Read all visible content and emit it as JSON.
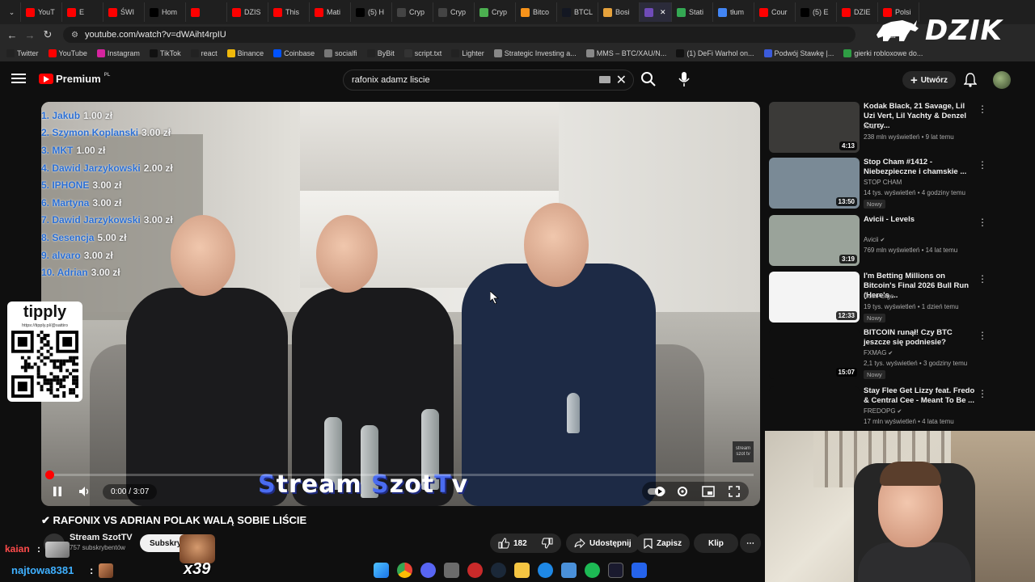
{
  "browser": {
    "tabs": [
      {
        "label": "YouT",
        "icon": "youtube-icon",
        "color": "#ff0000"
      },
      {
        "label": "E",
        "icon": "youtube-icon",
        "color": "#ff0000"
      },
      {
        "label": "ŚWI",
        "icon": "youtube-icon",
        "color": "#ff0000"
      },
      {
        "label": "Hom",
        "icon": "x-icon",
        "color": "#000000"
      },
      {
        "label": "",
        "icon": "youtube-icon",
        "color": "#ff0000"
      },
      {
        "label": "DZIS",
        "icon": "youtube-icon",
        "color": "#ff0000"
      },
      {
        "label": "This",
        "icon": "youtube-icon",
        "color": "#ff0000"
      },
      {
        "label": "Mati",
        "icon": "youtube-icon",
        "color": "#ff0000"
      },
      {
        "label": "(5) H",
        "icon": "x-icon",
        "color": "#000000"
      },
      {
        "label": "Cryp",
        "icon": "shield-icon",
        "color": "#444444"
      },
      {
        "label": "Cryp",
        "icon": "shield-icon",
        "color": "#444444"
      },
      {
        "label": "Cryp",
        "icon": "chrome-icon",
        "color": "#4caf50"
      },
      {
        "label": "Bitco",
        "icon": "bitcoin-icon",
        "color": "#f7931a"
      },
      {
        "label": "BTCL",
        "icon": "tradingview-icon",
        "color": "#131722"
      },
      {
        "label": "Bosi",
        "icon": "bookmark-icon",
        "color": "#e6a23c"
      },
      {
        "label": "",
        "icon": "active-tab-icon",
        "color": "#6f4bb8"
      },
      {
        "label": "Stati",
        "icon": "maps-icon",
        "color": "#34a853"
      },
      {
        "label": "tłum",
        "icon": "google-icon",
        "color": "#4285f4"
      },
      {
        "label": "Cour",
        "icon": "youtube-icon",
        "color": "#ff0000"
      },
      {
        "label": "(5) E",
        "icon": "x-icon",
        "color": "#000000"
      },
      {
        "label": "DZIE",
        "icon": "youtube-icon",
        "color": "#ff0000"
      },
      {
        "label": "Polsi",
        "icon": "youtube-icon",
        "color": "#ff0000"
      }
    ],
    "url": "youtube.com/watch?v=dWAiht4rpIU",
    "bookmarks": [
      {
        "label": "Twitter",
        "color": "#222222"
      },
      {
        "label": "YouTube",
        "color": "#ff0000"
      },
      {
        "label": "Instagram",
        "color": "#d6249f"
      },
      {
        "label": "TikTok",
        "color": "#111111"
      },
      {
        "label": "react",
        "color": "#222222"
      },
      {
        "label": "Binance",
        "color": "#f0b90b"
      },
      {
        "label": "Coinbase",
        "color": "#0052ff"
      },
      {
        "label": "socialfi",
        "color": "#777777"
      },
      {
        "label": "ByBit",
        "color": "#222222"
      },
      {
        "label": "script.txt",
        "color": "#333333"
      },
      {
        "label": "Lighter",
        "color": "#222222"
      },
      {
        "label": "Strategic Investing a...",
        "color": "#888888"
      },
      {
        "label": "MMS – BTC/XAU/N...",
        "color": "#888888"
      },
      {
        "label": "(1) DeFi Warhol on...",
        "color": "#111111"
      },
      {
        "label": "Podwój Stawkę |...",
        "color": "#3b5bdb"
      },
      {
        "label": "gierki robloxowe do...",
        "color": "#2f9e44"
      }
    ],
    "overlay_logo": "DZIK"
  },
  "youtube": {
    "logo": "Premium",
    "logo_region": "PL",
    "search_value": "rafonix adamz liscie",
    "create_label": "Utwórz",
    "video": {
      "title": "✔ RAFONIX VS ADRIAN POLAK WALĄ SOBIE LIŚCIE",
      "overlay_title_part1": "S",
      "overlay_title_part2": "tream ",
      "overlay_title_part3": "S",
      "overlay_title_part4": "zot",
      "overlay_title_part5": "T",
      "overlay_title_part6": "v",
      "watermark": "stream szot tv",
      "time": "0:00 / 3:07",
      "progress": 0.0,
      "donations": [
        {
          "name": "1. Jakub",
          "amount": "1.00 zł"
        },
        {
          "name": "2. Szymon Koplanski",
          "amount": "3.00 zł"
        },
        {
          "name": "3. MKT",
          "amount": "1.00 zł"
        },
        {
          "name": "4. Dawid Jarzykowski",
          "amount": "2.00 zł"
        },
        {
          "name": "5. IPHONE",
          "amount": "3.00 zł"
        },
        {
          "name": "6. Martyna",
          "amount": "3.00 zł"
        },
        {
          "name": "7. Dawid Jarzykowski",
          "amount": "3.00 zł"
        },
        {
          "name": "8. Sesencja",
          "amount": "5.00 zł"
        },
        {
          "name": "9. alvaro",
          "amount": "3.00 zł"
        },
        {
          "name": "10. Adrian",
          "amount": "3.00 zł"
        }
      ]
    },
    "channel": {
      "name": "Stream SzotTV",
      "subscribers": "757 subskrybentów",
      "subscribe_label": "Subskrybuj"
    },
    "actions": {
      "likes": "182",
      "share": "Udostępnij",
      "save": "Zapisz",
      "clip": "Klip"
    },
    "recommendations": [
      {
        "title": "Kodak Black, 21 Savage, Lil Uzi Vert, Lil Yachty & Denzel Curry...",
        "channel": "XXL",
        "verified": true,
        "meta": "238 mln wyświetleń • 9 lat temu",
        "duration": "4:13",
        "badge": "",
        "thumb_color": "#3b3a38"
      },
      {
        "title": "Stop Cham #1412 - Niebezpieczne i chamskie ...",
        "channel": "STOP CHAM",
        "verified": false,
        "meta": "14 tys. wyświetleń • 4 godziny temu",
        "duration": "13:50",
        "badge": "Nowy",
        "thumb_color": "#7a8a96"
      },
      {
        "title": "Avicii - Levels",
        "channel": "Avicii",
        "verified": true,
        "meta": "769 mln wyświetleń • 14 lat temu",
        "duration": "3:19",
        "badge": "",
        "thumb_color": "#9aa39a"
      },
      {
        "title": "I'm Betting Millions on Bitcoin's Final 2026 Bull Run (Here's ...",
        "channel": "CoinForge",
        "verified": false,
        "meta": "19 tys. wyświetleń • 1 dzień temu",
        "duration": "12:33",
        "badge": "Nowy",
        "thumb_color": "#f4f4f4"
      },
      {
        "title": "BITCOIN runął! Czy BTC jeszcze się podniesie?",
        "channel": "FXMAG",
        "verified": true,
        "meta": "2,1 tys. wyświetleń • 3 godziny temu",
        "duration": "15:07",
        "badge": "Nowy",
        "thumb_color": "#0f0f0f"
      },
      {
        "title": "Stay Flee Get Lizzy feat. Fredo & Central Cee - Meant To Be ...",
        "channel": "FREDOPG",
        "verified": true,
        "meta": "17 mln wyświetleń • 4 lata temu",
        "duration": "",
        "badge": "",
        "thumb_color": "#0f0f0f"
      }
    ]
  },
  "overlay": {
    "tipply_logo": "tipply",
    "tipply_link": "https://tipply.pl/@sattiro",
    "chat1_user": "kaian",
    "chat2_user": "najtowa8381",
    "chat_multiplier": "x39",
    "colon": ":"
  }
}
